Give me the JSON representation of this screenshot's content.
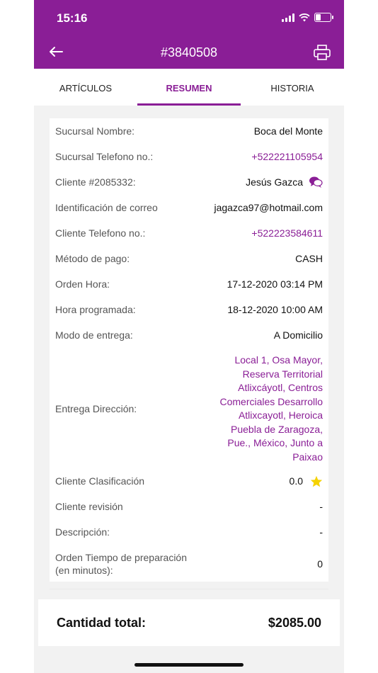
{
  "status_bar": {
    "time": "15:16"
  },
  "header": {
    "title": "#3840508"
  },
  "tabs": [
    {
      "label": "ARTÍCULOS",
      "active": false
    },
    {
      "label": "RESUMEN",
      "active": true
    },
    {
      "label": "HISTORIA",
      "active": false
    }
  ],
  "summary": {
    "branch_name_label": "Sucursal Nombre:",
    "branch_name_value": "Boca del Monte",
    "branch_phone_label": "Sucursal Telefono no.:",
    "branch_phone_value": "+522221105954",
    "customer_label": "Cliente #2085332:",
    "customer_value": "Jesús Gazca",
    "email_label": "Identificación de correo",
    "email_value": "jagazca97@hotmail.com",
    "customer_phone_label": "Cliente Telefono no.:",
    "customer_phone_value": "+522223584611",
    "payment_label": "Método de pago:",
    "payment_value": "CASH",
    "order_time_label": "Orden Hora:",
    "order_time_value": "17-12-2020 03:14 PM",
    "scheduled_time_label": "Hora programada:",
    "scheduled_time_value": "18-12-2020 10:00 AM",
    "delivery_mode_label": "Modo de entrega:",
    "delivery_mode_value": "A Domicilio",
    "delivery_address_label": "Entrega Dirección:",
    "delivery_address_value": "Local 1, Osa Mayor, Reserva Territorial Atlixcáyotl, Centros Comerciales Desarrollo Atlixcayotl, Heroica Puebla de Zaragoza, Pue., México, Junto a Paixao",
    "rating_label": "Cliente Clasificación",
    "rating_value": "0.0",
    "review_label": "Cliente revisión",
    "review_value": "-",
    "description_label": "Descripción:",
    "description_value": "-",
    "prep_time_label": "Orden Tiempo de preparación (en minutos):",
    "prep_time_value": "0"
  },
  "total": {
    "label": "Cantidad total:",
    "value": "$2085.00"
  },
  "colors": {
    "accent": "#8a1e96",
    "star": "#f5d200"
  }
}
